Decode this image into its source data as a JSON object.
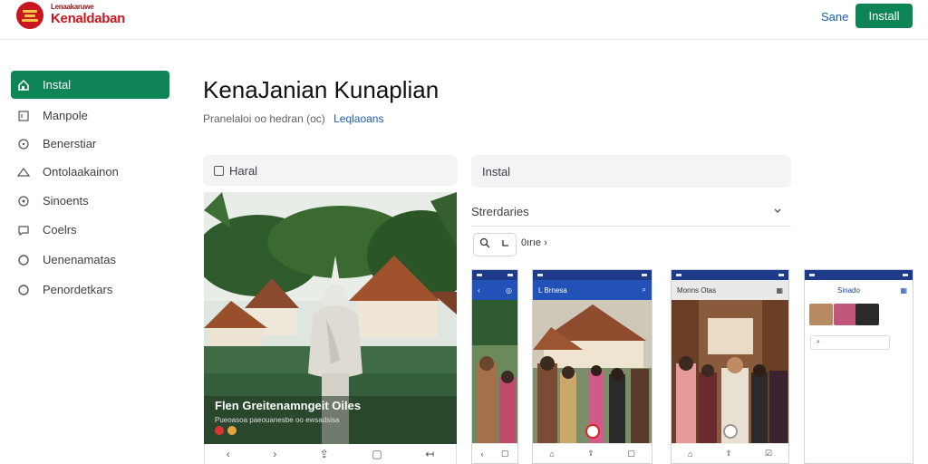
{
  "header": {
    "brand_top": "Lenaakaruwe",
    "brand_name": "Kenaldaban",
    "save_label": "Sane",
    "install_label": "Install"
  },
  "sidebar": {
    "items": [
      {
        "label": "Instal",
        "icon": "home-icon",
        "active": true
      },
      {
        "label": "Manpole",
        "icon": "document-icon",
        "active": false
      },
      {
        "label": "Benerstiar",
        "icon": "clock-icon",
        "active": false
      },
      {
        "label": "Ontolaakainon",
        "icon": "cloud-icon",
        "active": false
      },
      {
        "label": "Sinoents",
        "icon": "target-icon",
        "active": false
      },
      {
        "label": "Coelrs",
        "icon": "chat-icon",
        "active": false
      },
      {
        "label": "Uenenamatas",
        "icon": "circle-icon",
        "active": false
      },
      {
        "label": "Penordetkars",
        "icon": "circle-icon",
        "active": false
      }
    ]
  },
  "main": {
    "title": "KenaJanian Kunaplian",
    "subtitle": "Pranelaloi oo hedran (oc)",
    "subtitle_link": "Leqlaoans",
    "left_field": "Haral",
    "right_field": "Instal",
    "select_label": "Strerdaries",
    "search_extra": "0ırıe",
    "hero_caption": "Flen Greitenamngeit Oiles",
    "hero_sub": "Pueoasoa paeouanesbe oo ewsadsisa",
    "phone1_bar": "",
    "phone2_bar": "L Brnesa",
    "phone3_bar": "Monns Otas",
    "phone4_bar": "Sinado"
  },
  "colors": {
    "accent": "#0f8456",
    "link": "#1a5fb4",
    "brand_red": "#c8171e",
    "phone_bar": "#2251b8"
  }
}
